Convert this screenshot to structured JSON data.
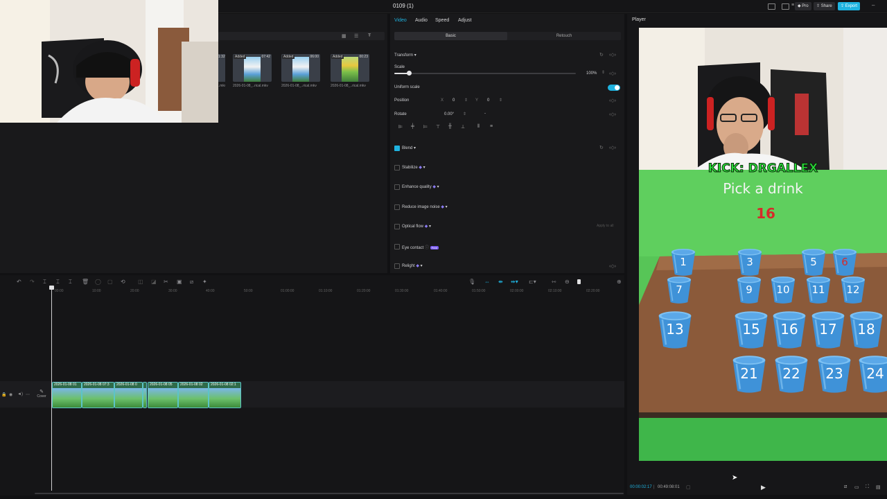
{
  "app": {
    "project_title": "0109 (1)",
    "pro_label": "Pro",
    "share_label": "Share",
    "export_label": "Export",
    "accent_color": "#1fb3e0"
  },
  "media": {
    "items": [
      {
        "added": "Added",
        "duration": "07:42",
        "name": "2026-01-08_..rical.mkv"
      },
      {
        "added": "Added",
        "duration": "06:00",
        "name": "2026-01-08_..rical.mkv"
      },
      {
        "added": "Added",
        "duration": "00:23",
        "name": "2026-01-08_..rical.mkv"
      }
    ],
    "partial_duration": "1:32",
    "partial_name": "...mkv"
  },
  "properties": {
    "tabs": [
      "Video",
      "Audio",
      "Speed",
      "Adjust"
    ],
    "active_tab": "Video",
    "subtabs": [
      "Basic",
      "Retouch"
    ],
    "transform_label": "Transform",
    "scale_label": "Scale",
    "scale_value": "100%",
    "scale_fraction": 0.08,
    "uniform_scale_label": "Uniform scale",
    "uniform_scale_on": true,
    "position_label": "Position",
    "pos_x_label": "X",
    "pos_x": "0",
    "pos_y_label": "Y",
    "pos_y": "0",
    "rotate_label": "Rotate",
    "rotate_value": "0.00°",
    "rotate_dash": "-",
    "blend_label": "Blend",
    "stabilize_label": "Stabilize",
    "enhance_label": "Enhance quality",
    "noise_label": "Reduce image noise",
    "optical_label": "Optical flow",
    "optical_apply": "Apply to all",
    "eye_label": "Eye contact",
    "eye_badge": "Free",
    "relight_label": "Relight"
  },
  "timeline": {
    "ruler": [
      "00:00",
      "10:00",
      "20:00",
      "30:00",
      "40:00",
      "50:00",
      "01:00:00",
      "01:10:00",
      "01:20:00",
      "01:30:00",
      "01:40:00",
      "01:50:00",
      "02:00:00",
      "02:10:00",
      "02:20:00"
    ],
    "cover_label": "Cover",
    "clips": [
      {
        "label": "2026-01-08 01"
      },
      {
        "label": "2026-01-08 07:3"
      },
      {
        "label": "2026-01-08 0"
      },
      {
        "label": "2026-01-08 05"
      },
      {
        "label": "2026-01-08 02"
      },
      {
        "label": "2026-01-08 02:1"
      }
    ]
  },
  "player": {
    "title": "Player",
    "current_time": "00:00:02:17",
    "total_time": "00:49:08:01",
    "overlay_banner": "KICK: DRGALLEX",
    "game_title": "Pick a drink",
    "game_number": "16",
    "cups": [
      "1",
      "3",
      "5",
      "6",
      "7",
      "9",
      "10",
      "11",
      "12",
      "13",
      "15",
      "16",
      "17",
      "18",
      "21",
      "22",
      "23",
      "24"
    ]
  }
}
